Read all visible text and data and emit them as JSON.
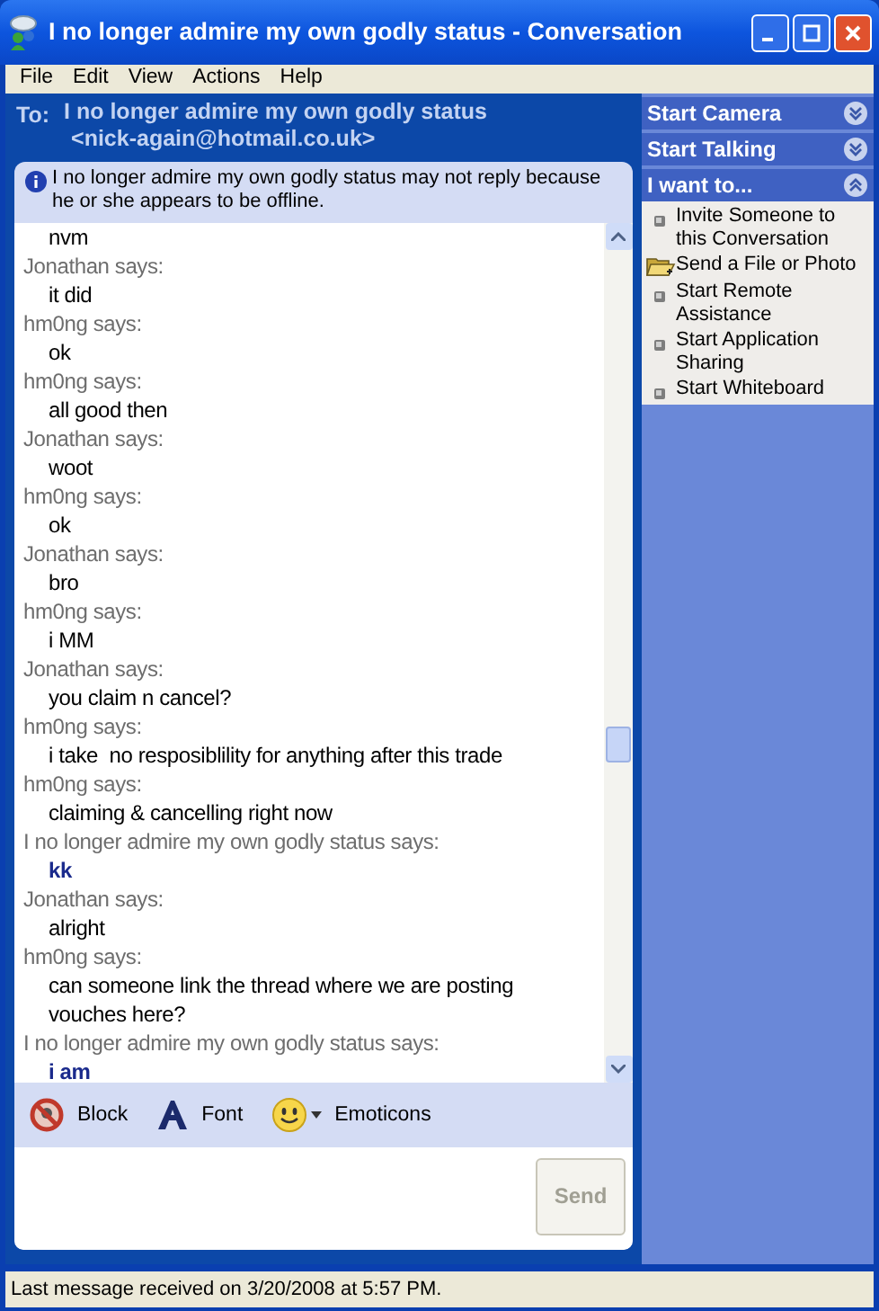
{
  "window": {
    "title": "I no longer admire my own godly status - Conversation"
  },
  "menu": [
    "File",
    "Edit",
    "View",
    "Actions",
    "Help"
  ],
  "to": {
    "label": "To:",
    "name": "I no longer admire my own godly status",
    "email": "<nick-again@hotmail.co.uk>"
  },
  "notice": "I no longer admire my own godly status may not reply because he or she appears to be offline.",
  "messages": [
    {
      "kind": "contact",
      "text": "nvm"
    },
    {
      "kind": "contact",
      "sender": "Jonathan says:",
      "text": "it did"
    },
    {
      "kind": "contact",
      "sender": "hm0ng says:",
      "text": "ok"
    },
    {
      "kind": "contact",
      "sender": "hm0ng says:",
      "text": "all good then"
    },
    {
      "kind": "contact",
      "sender": "Jonathan says:",
      "text": "woot"
    },
    {
      "kind": "contact",
      "sender": "hm0ng says:",
      "text": "ok"
    },
    {
      "kind": "contact",
      "sender": "Jonathan says:",
      "text": "bro"
    },
    {
      "kind": "contact",
      "sender": "hm0ng says:",
      "text": "i MM"
    },
    {
      "kind": "contact",
      "sender": "Jonathan says:",
      "text": "you claim n cancel?"
    },
    {
      "kind": "contact",
      "sender": "hm0ng says:",
      "text": "i take  no resposiblility for anything after this trade"
    },
    {
      "kind": "contact",
      "sender": "hm0ng says:",
      "text": "claiming & cancelling right now"
    },
    {
      "kind": "own",
      "sender": "I no longer admire my own godly status says:",
      "text": "kk"
    },
    {
      "kind": "contact",
      "sender": "Jonathan says:",
      "text": "alright"
    },
    {
      "kind": "contact",
      "sender": "hm0ng says:",
      "text": "can someone link the thread where we are posting vouches here?"
    },
    {
      "kind": "own",
      "sender": "I no longer admire my own godly status says:",
      "text": "i am"
    }
  ],
  "toolbar": [
    {
      "kind": "block",
      "label": "Block"
    },
    {
      "kind": "font",
      "label": "Font"
    },
    {
      "kind": "emoticons",
      "label": "Emoticons"
    }
  ],
  "send": {
    "label": "Send",
    "disabled": true
  },
  "sidebar": [
    {
      "title": "Start Camera",
      "expanded": false
    },
    {
      "title": "Start Talking",
      "expanded": false
    },
    {
      "title": "I want to...",
      "expanded": true,
      "items": [
        {
          "kind": "action",
          "label": "Invite Someone to this Conversation"
        },
        {
          "kind": "file",
          "label": "Send a File or Photo"
        },
        {
          "kind": "action",
          "label": "Start Remote Assistance"
        },
        {
          "kind": "action",
          "label": "Start Application Sharing"
        },
        {
          "kind": "action",
          "label": "Start Whiteboard"
        }
      ]
    }
  ],
  "status_bar": "Last message received on 3/20/2008 at 5:57 PM."
}
